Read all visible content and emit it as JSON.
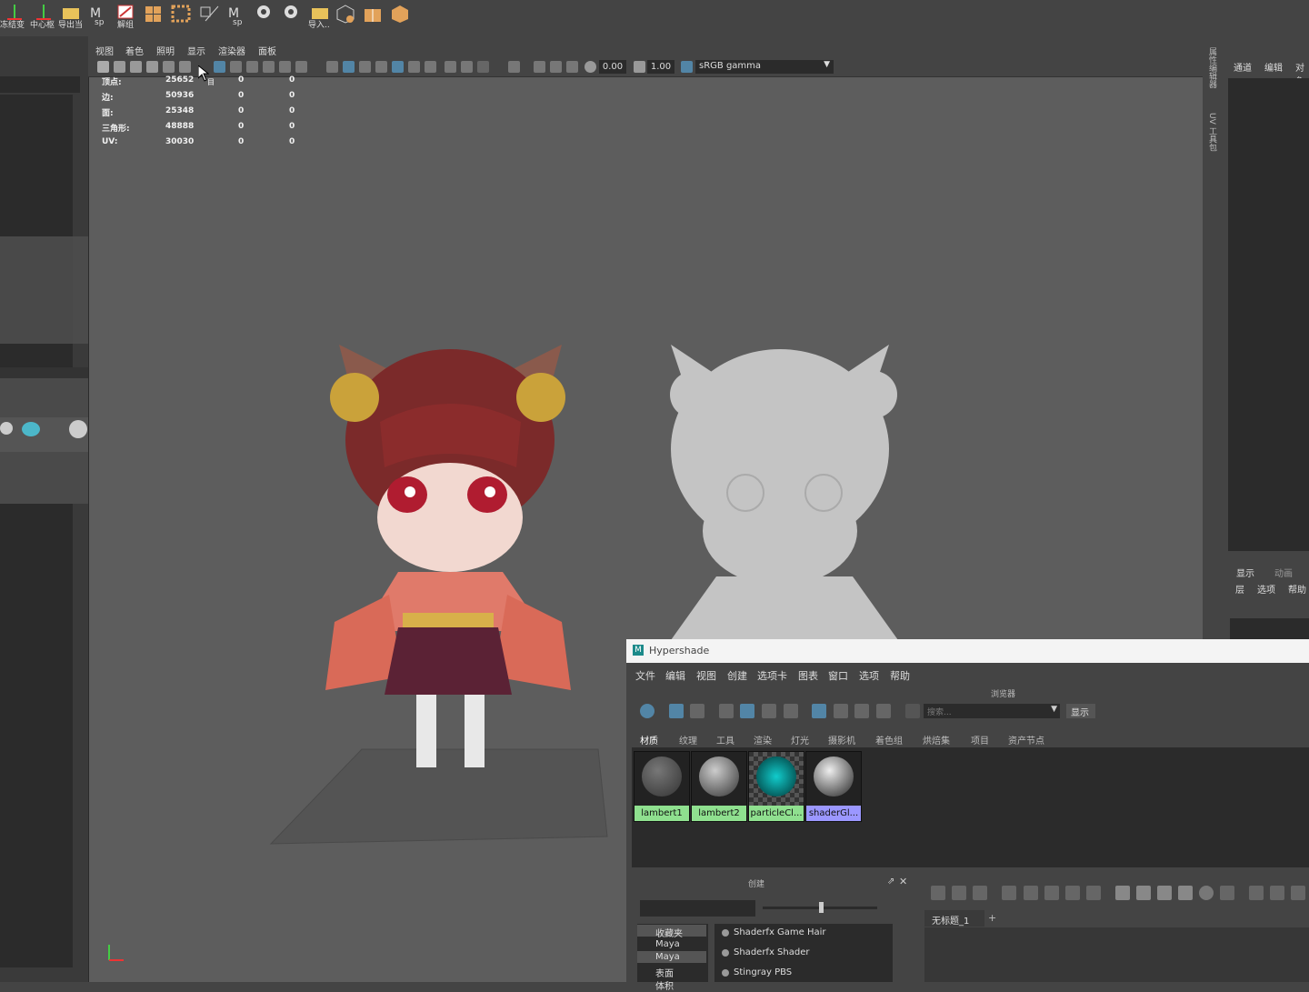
{
  "shelf": {
    "items": [
      {
        "label": "冻结变",
        "icon": "freeze-icon"
      },
      {
        "label": "中心枢",
        "icon": "center-pivot-icon"
      },
      {
        "label": "导出当",
        "icon": "export-folder-icon"
      },
      {
        "label": "sp",
        "icon": "substance-icon"
      },
      {
        "label": "解组",
        "icon": "ungroup-icon"
      },
      {
        "label": "",
        "icon": "grid-icon"
      },
      {
        "label": "",
        "icon": "grid-dots-icon"
      },
      {
        "label": "",
        "icon": "uv-icon"
      },
      {
        "label": "sp",
        "icon": "substance-icon"
      },
      {
        "label": "",
        "icon": "python-icon"
      },
      {
        "label": "",
        "icon": "python-icon"
      },
      {
        "label": "导入..",
        "icon": "import-folder-icon"
      },
      {
        "label": "",
        "icon": "cube-icon"
      },
      {
        "label": "",
        "icon": "box-open-icon"
      },
      {
        "label": "",
        "icon": "box-icon"
      }
    ]
  },
  "viewport": {
    "menu": [
      "视图",
      "着色",
      "照明",
      "显示",
      "渲染器",
      "面板"
    ],
    "exposure": "0.00",
    "gamma": "1.00",
    "color_space": "sRGB gamma",
    "hud": {
      "rows": [
        {
          "label": "顶点:",
          "values": [
            "25652",
            "0",
            "0"
          ]
        },
        {
          "label": "边:",
          "values": [
            "50936",
            "0",
            "0"
          ]
        },
        {
          "label": "面:",
          "values": [
            "25348",
            "0",
            "0"
          ]
        },
        {
          "label": "三角形:",
          "values": [
            "48888",
            "0",
            "0"
          ]
        },
        {
          "label": "UV:",
          "values": [
            "30030",
            "0",
            "0"
          ]
        }
      ]
    },
    "tooltip_glyph": "目"
  },
  "side_strip": {
    "tabs": [
      "属性编辑器",
      "UV 工具包"
    ]
  },
  "right_panel": {
    "top_menu": [
      "通道",
      "编辑",
      "对象"
    ],
    "layer_tabs": [
      "显示",
      "动画"
    ],
    "layer_menu": [
      "层",
      "选项",
      "帮助"
    ]
  },
  "hypershade": {
    "title": "Hypershade",
    "menu": [
      "文件",
      "编辑",
      "视图",
      "创建",
      "选项卡",
      "图表",
      "窗口",
      "选项",
      "帮助"
    ],
    "browser_label": "浏览器",
    "search_placeholder": "搜索...",
    "show_button": "显示",
    "tabs": [
      "材质",
      "纹理",
      "工具",
      "渲染",
      "灯光",
      "摄影机",
      "着色组",
      "烘焙集",
      "项目",
      "资产节点"
    ],
    "swatches": [
      {
        "label": "lambert1",
        "color": "#8fe08f"
      },
      {
        "label": "lambert2",
        "color": "#8fe08f"
      },
      {
        "label": "particleCl...",
        "color": "#8fe08f"
      },
      {
        "label": "shaderGl...",
        "color": "#9b97ff"
      }
    ],
    "create_label": "创建",
    "tree": [
      "收藏夹",
      "Maya",
      "Maya",
      "表面",
      "体积"
    ],
    "node_list": [
      "Shaderfx Game Hair",
      "Shaderfx Shader",
      "Stingray PBS"
    ],
    "graph_tab": "无标题_1",
    "graph_tab_add": "+"
  },
  "colors": {
    "accent": "#5285a6",
    "viewport_bg": "#5d5d5d",
    "panel_bg": "#444444"
  }
}
